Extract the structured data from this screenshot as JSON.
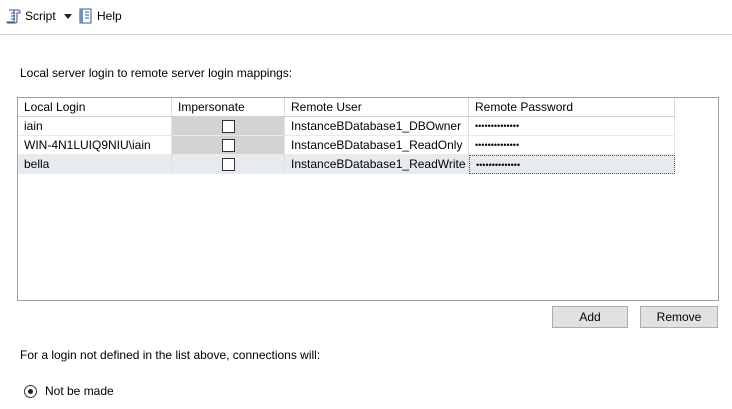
{
  "toolbar": {
    "script_label": "Script",
    "help_label": "Help",
    "icons": {
      "script": "script-icon",
      "dropdown": "chevron-down-icon",
      "help": "help-book-icon"
    }
  },
  "mappings_label": "Local server login to remote server login mappings:",
  "grid": {
    "columns": [
      "Local Login",
      "Impersonate",
      "Remote User",
      "Remote Password"
    ],
    "rows": [
      {
        "local_login": "iain",
        "impersonate": false,
        "remote_user": "InstanceBDatabase1_DBOwner",
        "remote_password": "••••••••••••••"
      },
      {
        "local_login": "WIN-4N1LUIQ9NIU\\iain",
        "impersonate": false,
        "remote_user": "InstanceBDatabase1_ReadOnly",
        "remote_password": "••••••••••••••"
      },
      {
        "local_login": "bella",
        "impersonate": false,
        "remote_user": "InstanceBDatabase1_ReadWrite",
        "remote_password": "••••••••••••••",
        "selected": true
      }
    ]
  },
  "buttons": {
    "add": "Add",
    "remove": "Remove"
  },
  "undefined_login_label": "For a login not defined in the list above, connections will:",
  "option": {
    "label": "Not be made",
    "selected": true
  }
}
